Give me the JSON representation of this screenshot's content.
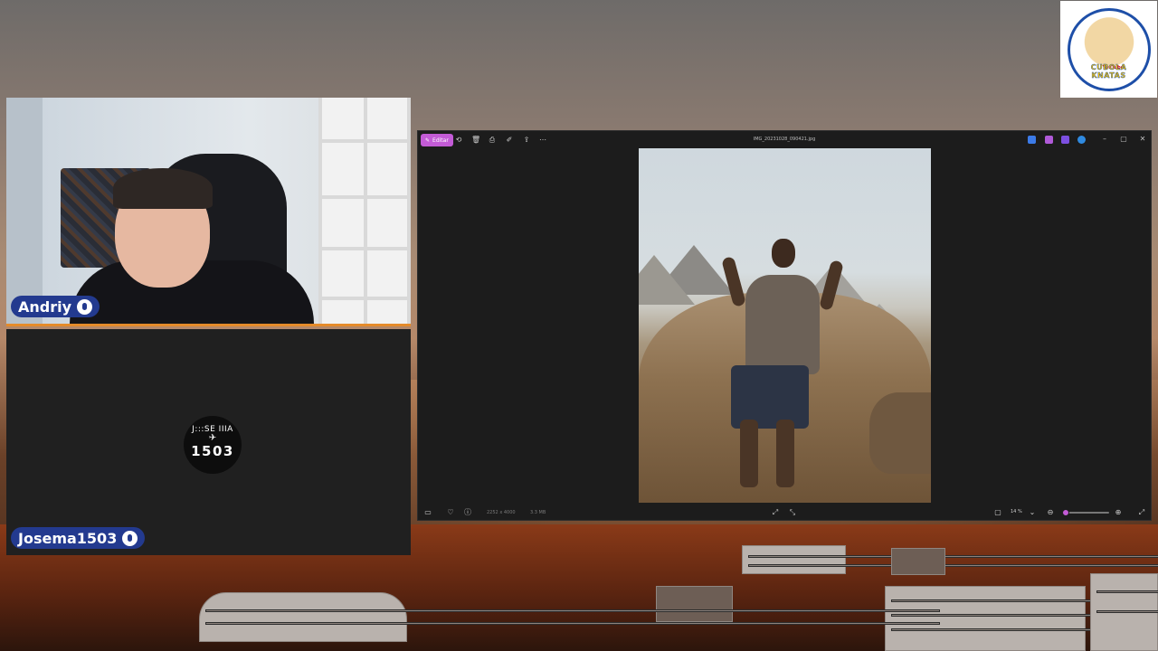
{
  "stream": {
    "logo": {
      "text": "CUBOLA KNATAS",
      "badge": "YouTube",
      "icon": "fox-guitar-logo-icon"
    },
    "participants": [
      {
        "name": "Andriy",
        "icon": "microphone-icon",
        "tag_color": "#233a8f"
      },
      {
        "name": "Josema1503",
        "icon": "microphone-icon",
        "tag_color": "#233a8f",
        "avatar_text": "1503",
        "avatar_crest": "J:::SE IIIA"
      }
    ],
    "accent_border_color": "#e58b2a"
  },
  "photos_app": {
    "toolbar": {
      "edit_label": "Editar",
      "icons": [
        "rotate-icon",
        "delete-icon",
        "print-icon",
        "edit-icon",
        "share-icon",
        "more-icon"
      ]
    },
    "title": "IMG_20231028_090421.jpg",
    "title_icons": [
      "designer-icon",
      "copilot-icon",
      "photos-ai-icon",
      "onedrive-icon"
    ],
    "window_controls": [
      "minimize-icon",
      "maximize-icon",
      "close-icon"
    ],
    "bottom_bar": {
      "dimensions": "2252 x 4000",
      "size": "3.3 MB",
      "zoom": "14 %",
      "zoom_fraction": 0.08
    },
    "accent_color": "#c35bd6"
  }
}
